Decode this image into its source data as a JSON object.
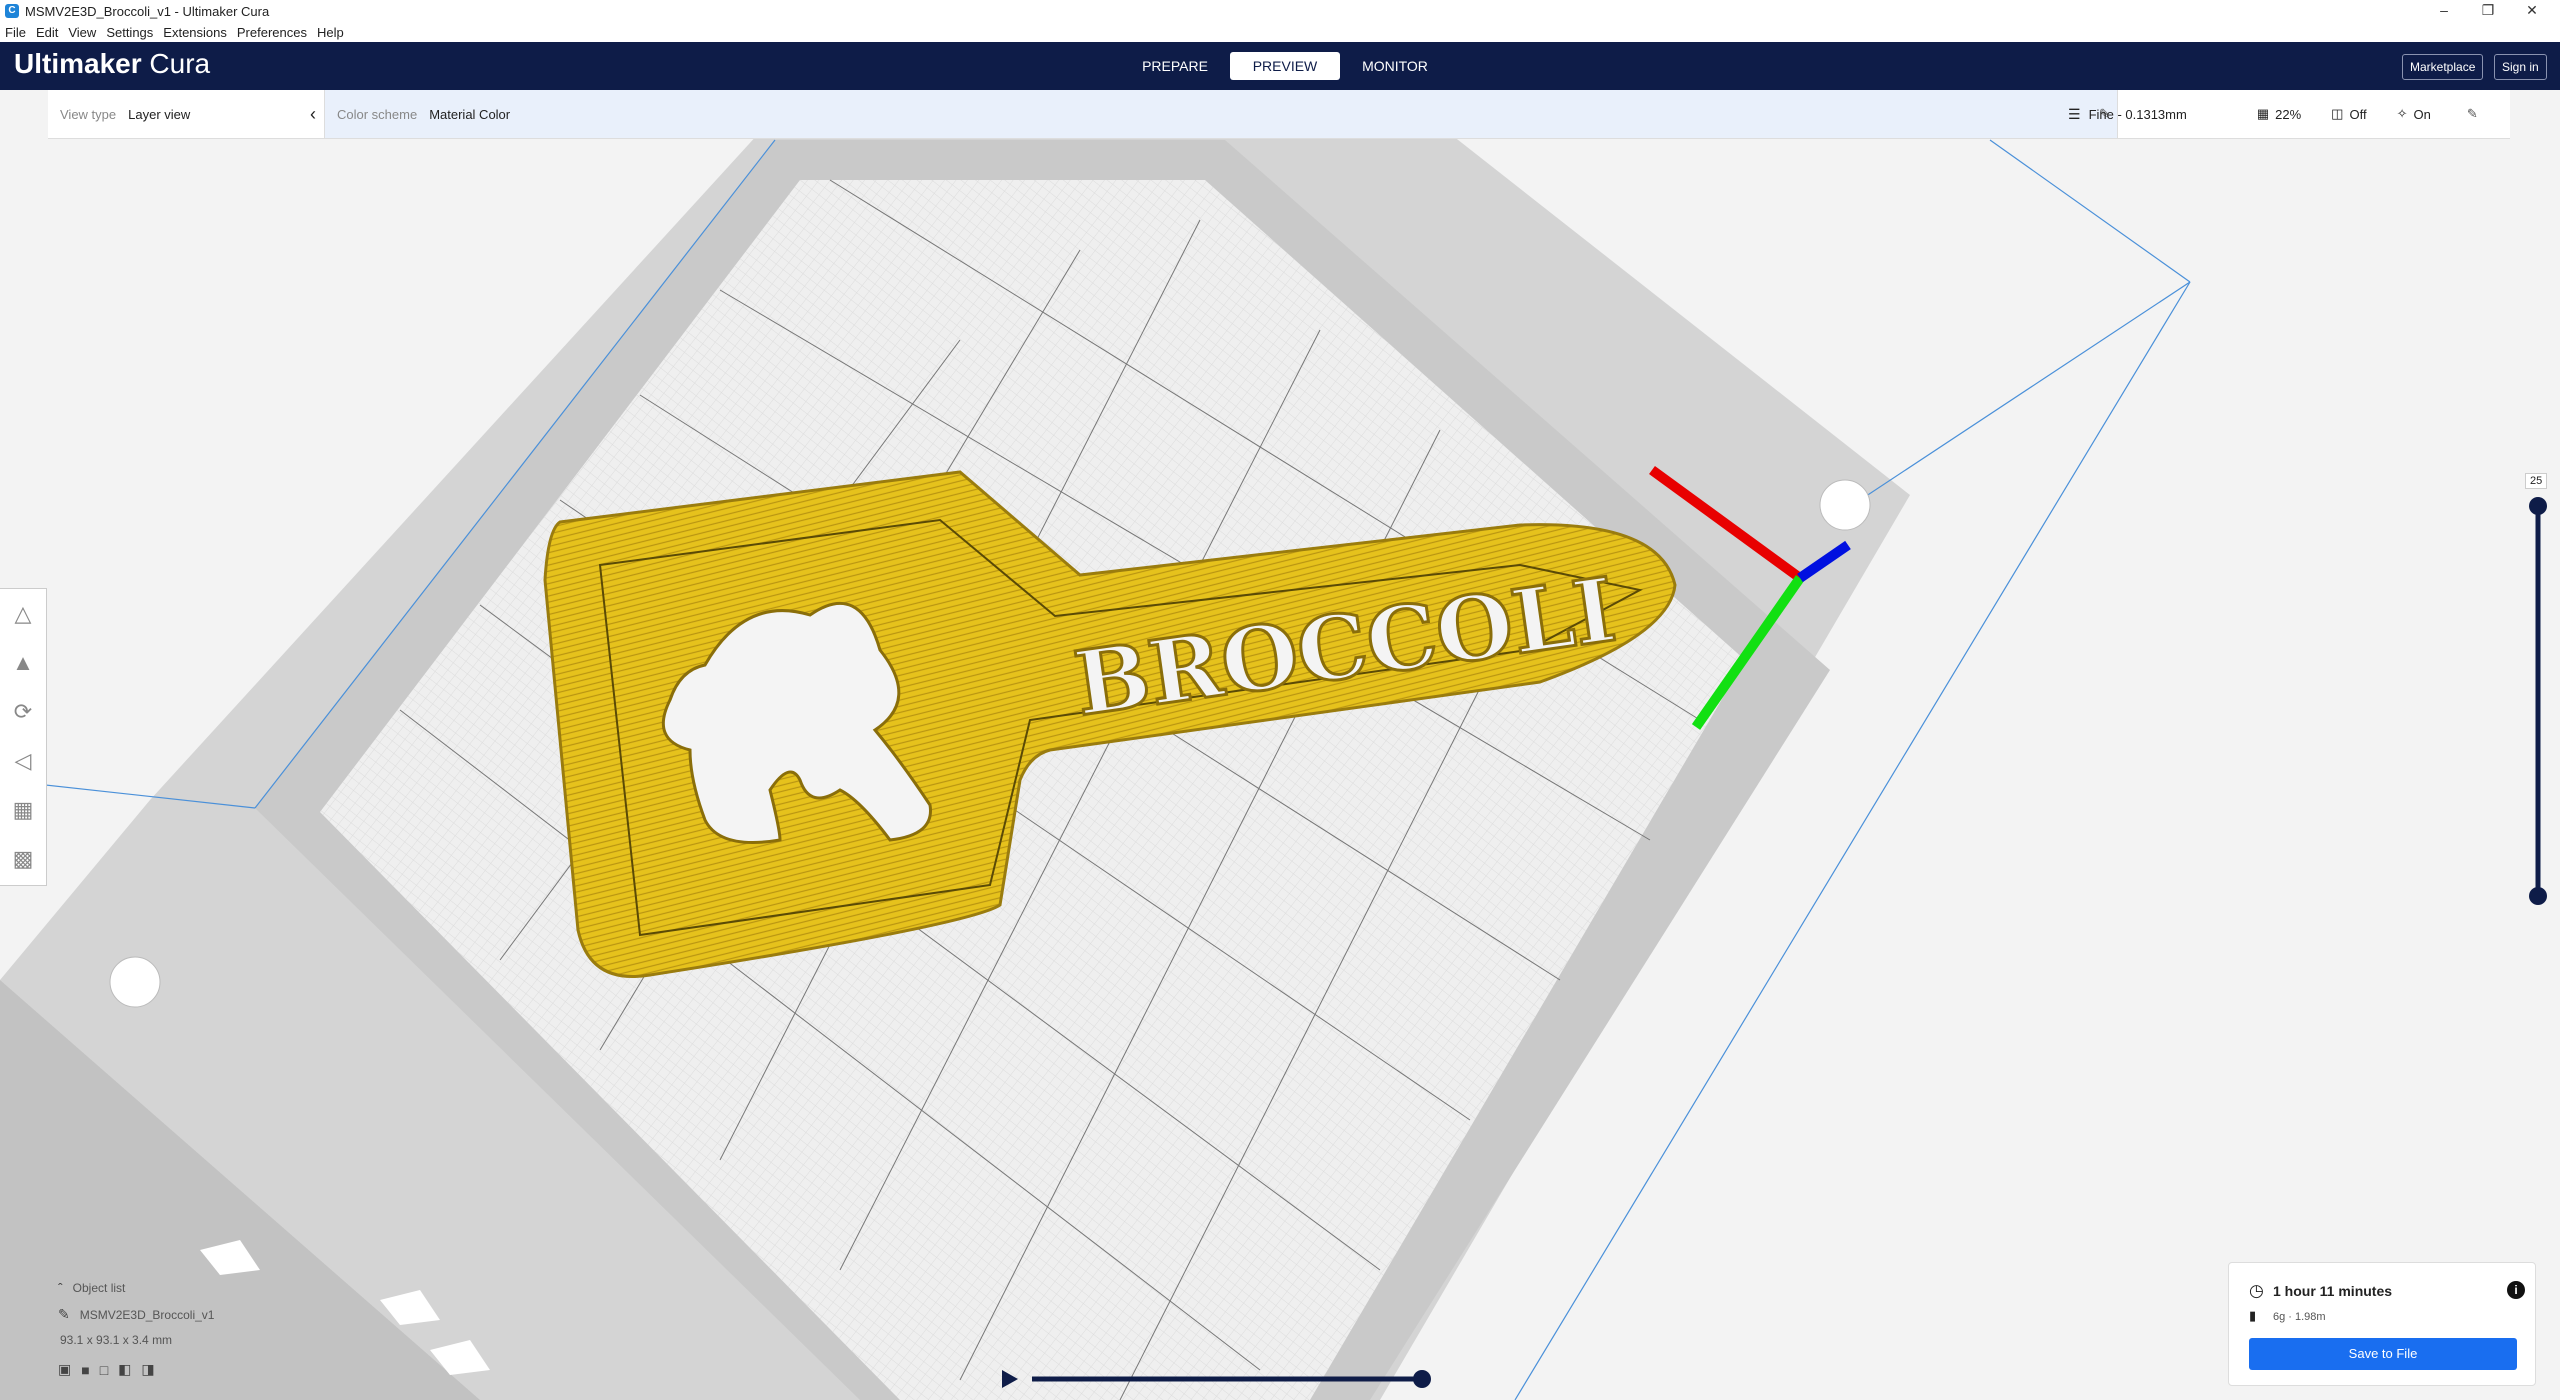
{
  "window": {
    "title": "MSMV2E3D_Broccoli_v1 - Ultimaker Cura",
    "app_icon": "C"
  },
  "menu": [
    "File",
    "Edit",
    "View",
    "Settings",
    "Extensions",
    "Preferences",
    "Help"
  ],
  "header": {
    "brand_bold": "Ultimaker",
    "brand_light": " Cura",
    "tabs": [
      "PREPARE",
      "PREVIEW",
      "MONITOR"
    ],
    "active_tab": "PREVIEW",
    "marketplace": "Marketplace",
    "signin": "Sign in",
    "bg_color": "#0e1c48"
  },
  "viewbar": {
    "view_type_label": "View type",
    "view_type_value": "Layer view",
    "color_scheme_label": "Color scheme",
    "color_scheme_value": "Material Color",
    "profile": "Fine - 0.1313mm",
    "infill": "22%",
    "support": "Off",
    "adhesion": "On"
  },
  "scene": {
    "text_label": "BROCCOLI",
    "material_color": "#e6c21c"
  },
  "layer_slider": {
    "current_layer": "25"
  },
  "object_panel": {
    "title": "Object list",
    "object_name": "MSMV2E3D_Broccoli_v1",
    "dimensions": "93.1 x 93.1 x 3.4 mm"
  },
  "print_info": {
    "time": "1 hour 11 minutes",
    "material": "6g · 1.98m",
    "save_label": "Save to File",
    "accent": "#196ef0"
  }
}
